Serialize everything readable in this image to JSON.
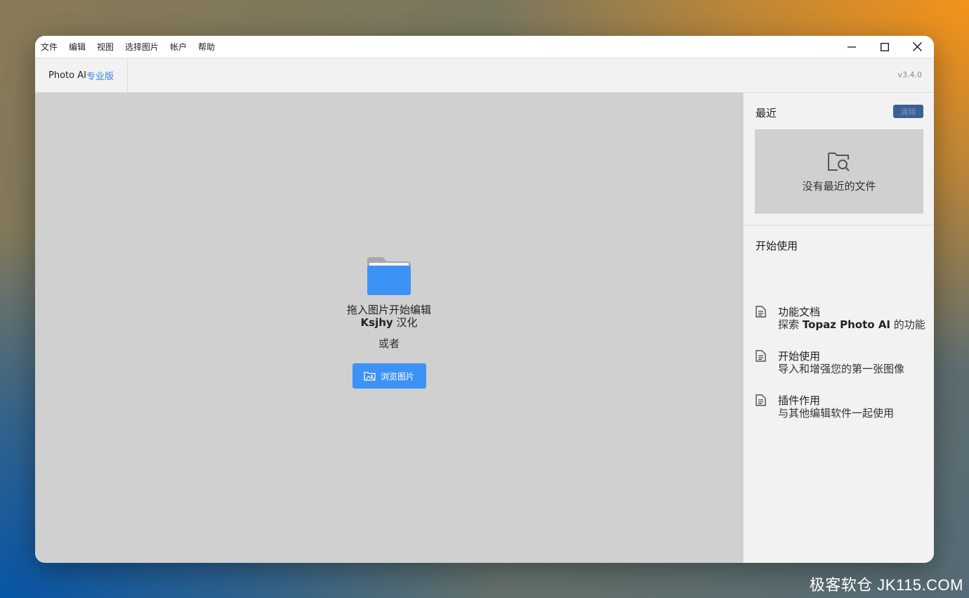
{
  "menubar": {
    "items": [
      "文件",
      "编辑",
      "视图",
      "选择图片",
      "帐户",
      "帮助"
    ]
  },
  "header": {
    "app_name": "Photo AI",
    "edition": "专业版",
    "version": "v3.4.0"
  },
  "drop_zone": {
    "title": "拖入图片开始编辑",
    "subtitle_bold": "Ksjhy",
    "subtitle_rest": " 汉化",
    "or_text": "或者",
    "browse_label": "浏览图片"
  },
  "sidebar": {
    "recent_title": "最近",
    "clear_label": "清除",
    "recent_empty": "没有最近的文件",
    "start_title": "开始使用",
    "docs": [
      {
        "title": "功能文档",
        "desc_pre": "探索 ",
        "desc_bold": "Topaz Photo AI",
        "desc_post": " 的功能"
      },
      {
        "title": "开始使用",
        "desc_pre": "导入和增强您的第一张图像",
        "desc_bold": "",
        "desc_post": ""
      },
      {
        "title": "插件作用",
        "desc_pre": "与其他编辑软件一起使用",
        "desc_bold": "",
        "desc_post": ""
      }
    ]
  },
  "watermark": "极客软仓 JK115.COM",
  "colors": {
    "accent": "#3d93f5",
    "clear_button": "#3d5f91",
    "canvas_bg": "#d0d0d0",
    "panel_bg": "#f2f2f2"
  }
}
